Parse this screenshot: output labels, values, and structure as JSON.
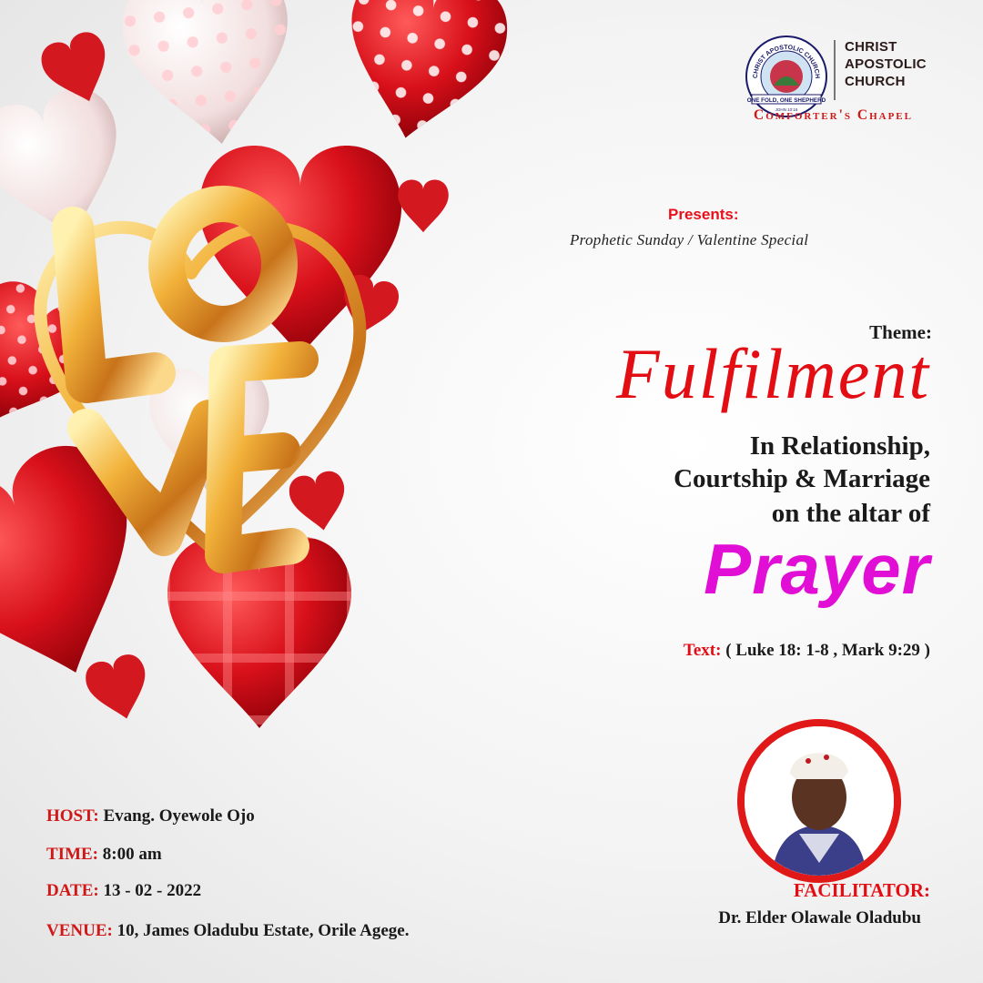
{
  "logo": {
    "seal_top_text": "CHRIST APOSTOLIC CHURCH",
    "seal_ribbon_text": "ONE FOLD, ONE SHEPHERD",
    "seal_verse_text": "JOHN 10:16",
    "name_line1": "CHRIST",
    "name_line2": "APOSTOLIC",
    "name_line3": "CHURCH",
    "chapel": "Comforter's Chapel"
  },
  "event": {
    "presents_label": "Presents:",
    "subtitle": "Prophetic Sunday / Valentine Special",
    "theme_label": "Theme:",
    "theme_headline": "Fulfilment",
    "theme_line1": "In Relationship,",
    "theme_line2": "Courtship & Marriage",
    "theme_line3": "on the altar of",
    "theme_emphasis": "Prayer",
    "scripture_label": "Text:",
    "scripture_value": "( Luke 18: 1-8 , Mark 9:29 )"
  },
  "facilitator": {
    "label": "FACILITATOR:",
    "name": "Dr. Elder Olawale Oladubu"
  },
  "details": {
    "host_label": "HOST:",
    "host_value": "Evang. Oyewole Ojo",
    "time_label": "TIME:",
    "time_value": "8:00 am",
    "date_label": "DATE:",
    "date_value": "13 - 02 - 2022",
    "venue_label": "VENUE:",
    "venue_value": "10, James Oladubu Estate, Orile Agege."
  },
  "colors": {
    "accent_red": "#e30d14",
    "accent_magenta": "#e10fd6",
    "gold": "#d89020"
  }
}
